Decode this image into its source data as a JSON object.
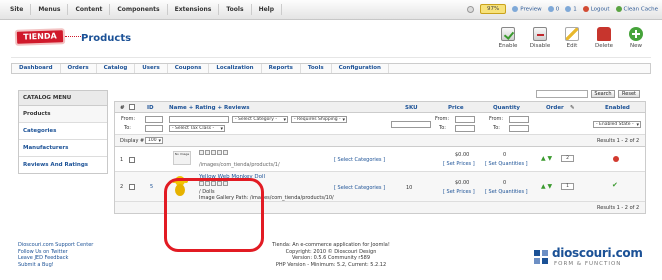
{
  "topbar": {
    "menu": [
      "Site",
      "Menus",
      "Content",
      "Components",
      "Extensions",
      "Tools",
      "Help"
    ],
    "pct": "97%",
    "preview": "Preview",
    "count1": "0",
    "count2": "1",
    "logout": "Logout",
    "clean": "Clean Cache"
  },
  "header": {
    "logo": "TIENDA",
    "title": "Products",
    "toolbar": [
      "Enable",
      "Disable",
      "Edit",
      "Delete",
      "New"
    ]
  },
  "nav": [
    "Dashboard",
    "Orders",
    "Catalog",
    "Users",
    "Coupons",
    "Localization",
    "Reports",
    "Tools",
    "Configuration"
  ],
  "sidebar": {
    "title": "CATALOG MENU",
    "items": [
      "Products",
      "Categories",
      "Manufacturers",
      "Reviews And Ratings"
    ]
  },
  "search": {
    "search_btn": "Search",
    "reset_btn": "Reset"
  },
  "grid": {
    "headers": {
      "num": "#",
      "id": "ID",
      "name": "Name + Rating + Reviews",
      "sku": "SKU",
      "price": "Price",
      "qty": "Quantity",
      "order": "Order",
      "enabled": "Enabled"
    },
    "filters": {
      "from": "From:",
      "to": "To:",
      "cat": "- Select Category -",
      "ship": "- Requires Shipping -",
      "tax": "- Select Tax Class -",
      "state": "- Enabled State -"
    },
    "display_label": "Display #",
    "display_value": "100",
    "results": "Results 1 - 2 of 2",
    "rows": [
      {
        "num": "1",
        "id": "",
        "path": "/images/com_tienda/products/1/",
        "categories": "[ Select Categories ]",
        "sku": "",
        "price": "$0.00",
        "set_prices": "[ Set Prices ]",
        "qty": "0",
        "set_qty": "[ Set Quantities ]",
        "order": "2",
        "thumb": "No Image"
      },
      {
        "num": "2",
        "id": "5",
        "name": "Yellow Web Monkey Doll",
        "cats": "/ Dolls",
        "gallery": "Image Gallery Path: /images/com_tienda/products/10/",
        "categories": "[ Select Categories ]",
        "sku": "10",
        "price": "$0.00",
        "set_prices": "[ Set Prices ]",
        "qty": "0",
        "set_qty": "[ Set Quantities ]",
        "order": "1"
      }
    ]
  },
  "footer": {
    "links": [
      "Dioscouri.com Support Center",
      "Follow Us on Twitter",
      "Leave JED Feedback",
      "Submit a Bug!"
    ],
    "center": [
      "Tienda: An e-commerce application for Joomla!",
      "Copyright: 2010 © Dioscouri Design",
      "Version: 0.5.6 Community r589",
      "PHP Version - Minimum: 5.2, Current: 5.2.12"
    ],
    "brand": "dioscouri.com",
    "tagline": "FORM & FUNCTION"
  }
}
